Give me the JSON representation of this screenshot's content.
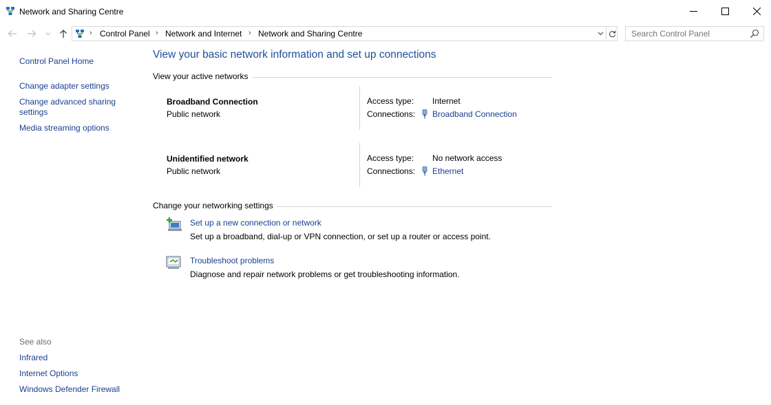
{
  "window": {
    "title": "Network and Sharing Centre"
  },
  "address": {
    "crumbs": [
      "Control Panel",
      "Network and Internet",
      "Network and Sharing Centre"
    ]
  },
  "search": {
    "placeholder": "Search Control Panel"
  },
  "sidebar": {
    "home": "Control Panel Home",
    "items": [
      "Change adapter settings",
      "Change advanced sharing",
      "settings",
      "Media streaming options"
    ],
    "see_also_label": "See also",
    "see_also": [
      "Infrared",
      "Internet Options",
      "Windows Defender Firewall"
    ]
  },
  "main": {
    "title": "View your basic network information and set up connections",
    "active_header": "View your active networks",
    "networks": [
      {
        "name": "Broadband Connection",
        "category": "Public network",
        "access_label": "Access type:",
        "access_value": "Internet",
        "conn_label": "Connections:",
        "conn_value": "Broadband Connection"
      },
      {
        "name": "Unidentified network",
        "category": "Public network",
        "access_label": "Access type:",
        "access_value": "No network access",
        "conn_label": "Connections:",
        "conn_value": "Ethernet"
      }
    ],
    "change_header": "Change your networking settings",
    "tasks": [
      {
        "link": "Set up a new connection or network",
        "desc": "Set up a broadband, dial-up or VPN connection, or set up a router or access point."
      },
      {
        "link": "Troubleshoot problems",
        "desc": "Diagnose and repair network problems or get troubleshooting information."
      }
    ]
  },
  "colors": {
    "link": "#1a3f8f",
    "heading": "#1e4e9a",
    "muted": "#6d6d6d",
    "border": "#d9d9d9"
  }
}
